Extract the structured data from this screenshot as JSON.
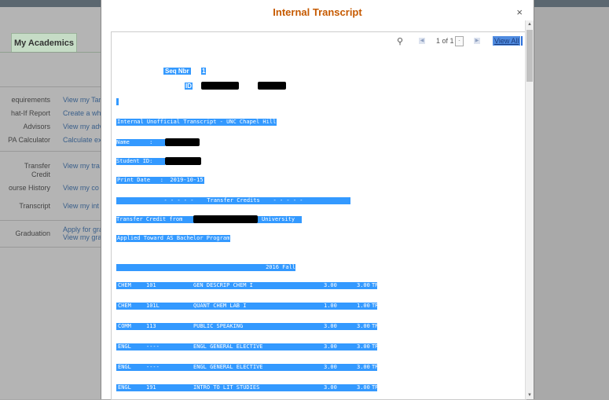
{
  "background": {
    "tab_label": "My Academics",
    "menu": [
      {
        "label": "equirements",
        "link": "View my Tar"
      },
      {
        "label": "hat-If Report",
        "link": "Create a wh"
      },
      {
        "label": "Advisors",
        "link": "View my adv"
      },
      {
        "label": "PA Calculator",
        "link": "Calculate ex"
      },
      {
        "label": "Transfer",
        "label2": "Credit",
        "link": "View my tra"
      },
      {
        "label": "ourse History",
        "link": "View my co"
      },
      {
        "label": "Transcript",
        "link": "View my int"
      },
      {
        "label": "Graduation",
        "link": "Apply for gra",
        "link2": "View my gra"
      }
    ]
  },
  "modal": {
    "title": "Internal Transcript",
    "close_label": "×",
    "toolbar": {
      "page_indicator": "1 of 1",
      "dropdown": "-",
      "view_all": "View All"
    }
  },
  "document": {
    "seq_label": "Seq Nbr",
    "seq_value": "1",
    "id_label": "ID",
    "heading": "Internal Unofficial Transcript - UNC Chapel Hill",
    "name_label": "Name      :",
    "student_id_label": "Student ID:",
    "print_date": "Print Date   :  2019-10-15",
    "transfer_banner": "- - - - -    Transfer Credits    - - - - -",
    "transfer_from_prefix": "Transfer Credit from",
    "transfer_from_suffix": "University",
    "applied_toward": "Applied Toward AS Bachelor Program",
    "term": "2016 Fall",
    "courses": [
      {
        "subject": "CHEM",
        "number": "101",
        "title": "GEN DESCRIP CHEM I",
        "attempted": "3.00",
        "earned": "3.00",
        "grade": "TR"
      },
      {
        "subject": "CHEM",
        "number": "101L",
        "title": "QUANT CHEM LAB I",
        "attempted": "1.00",
        "earned": "1.00",
        "grade": "TR"
      },
      {
        "subject": "COMM",
        "number": "113",
        "title": "PUBLIC SPEAKING",
        "attempted": "3.00",
        "earned": "3.00",
        "grade": "TR"
      },
      {
        "subject": "ENGL",
        "number": "----",
        "title": "ENGL GENERAL ELECTIVE",
        "attempted": "3.00",
        "earned": "3.00",
        "grade": "TR"
      },
      {
        "subject": "ENGL",
        "number": "----",
        "title": "ENGL GENERAL ELECTIVE",
        "attempted": "3.00",
        "earned": "3.00",
        "grade": "TR"
      },
      {
        "subject": "ENGL",
        "number": "191",
        "title": "INTRO TO LIT STUDIES",
        "attempted": "3.00",
        "earned": "3.00",
        "grade": "TR"
      }
    ]
  },
  "colors": {
    "title": "#c65a00",
    "selection": "#3399ff",
    "link": "#3a5f8a"
  },
  "icons": {
    "search": "search-icon",
    "close": "close-icon",
    "prev": "prev-page-icon",
    "next": "next-page-icon"
  }
}
